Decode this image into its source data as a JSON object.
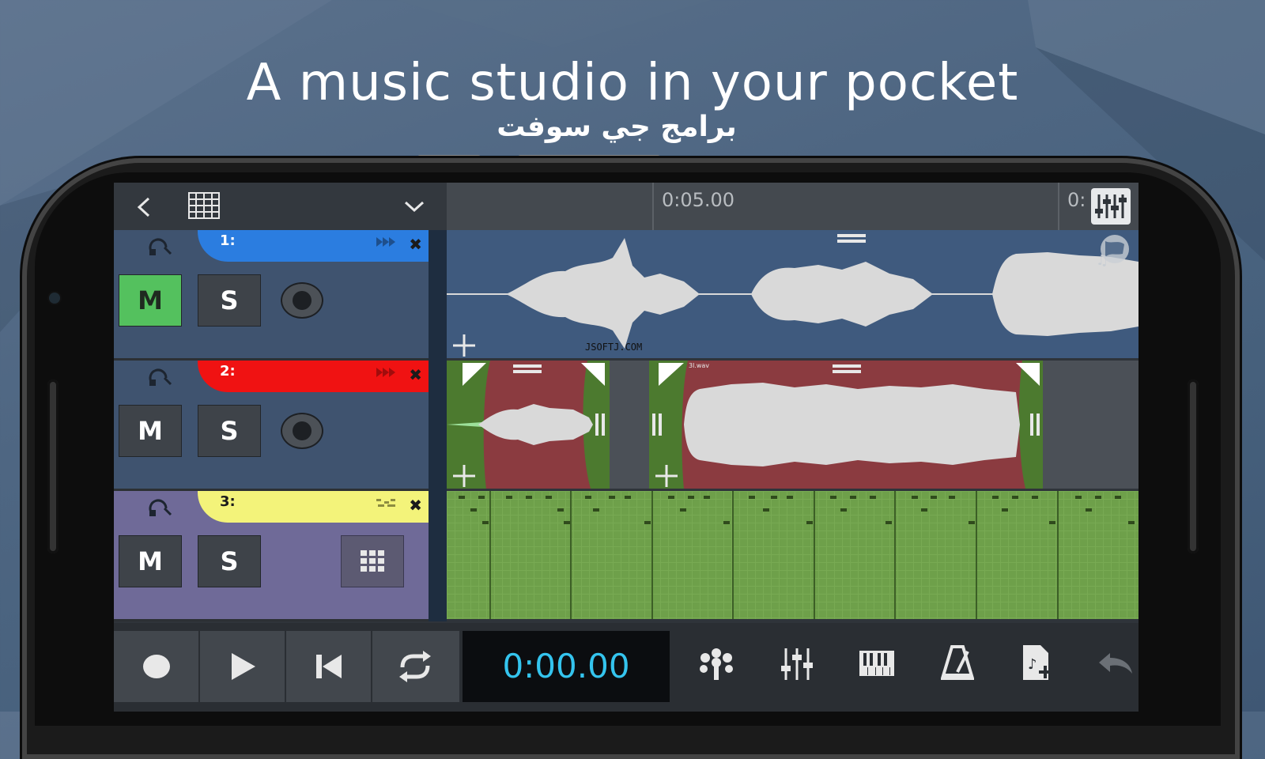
{
  "headline": "A music studio in your pocket",
  "subline": "برامج جي سوفت",
  "watermark": "JSOFTJ.COM",
  "timeline": {
    "marker_1": "0:05.00",
    "marker_2": "0:"
  },
  "tracks": [
    {
      "label": "1:",
      "color": "#2b7de0",
      "mute_label": "M",
      "solo_label": "S",
      "mute_active": true,
      "control_bg": "#3f536f",
      "lane_bg": "#3f5a7e"
    },
    {
      "label": "2:",
      "color": "#f01212",
      "mute_label": "M",
      "solo_label": "S",
      "mute_active": false,
      "control_bg": "#3f536f",
      "lane_bg": "#4b5057"
    },
    {
      "label": "3:",
      "color": "#f3f37a",
      "mute_label": "M",
      "solo_label": "S",
      "mute_active": false,
      "control_bg": "#6f6a98",
      "lane_bg": "#6ea04a"
    }
  ],
  "clip_label": "3l.wav",
  "transport": {
    "time": "0:00.00"
  },
  "icons": [
    "back-icon",
    "grid-icon",
    "chevron-down-icon",
    "mixer-icon",
    "globe-music-icon",
    "record-icon",
    "play-icon",
    "skip-back-icon",
    "loop-icon",
    "effects-icon",
    "sliders-icon",
    "piano-icon",
    "metronome-icon",
    "add-file-icon",
    "undo-icon"
  ],
  "colors": {
    "accent_time": "#34c4ee",
    "mute_on": "#54c15e"
  }
}
